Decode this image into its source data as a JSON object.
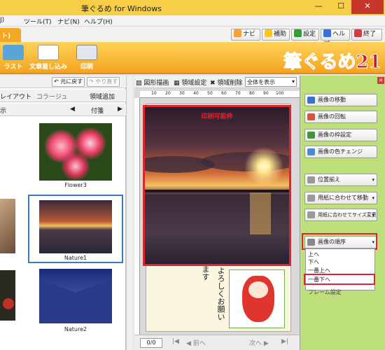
{
  "window": {
    "title": "筆ぐるめ for Windows",
    "minimize": "—",
    "maximize": "☐",
    "close": "✕"
  },
  "menu": [
    "ツール(T)",
    "ナビ(N)",
    "ヘルプ(H)"
  ],
  "menu_partial": "J)",
  "tabs": {
    "active": "ト)"
  },
  "top_buttons": [
    {
      "label": "ナビ",
      "color": "#f2a33a"
    },
    {
      "label": "補助",
      "color": "#f5c431"
    },
    {
      "label": "設定",
      "color": "#3a9a3a"
    },
    {
      "label": "ヘルプ",
      "color": "#3a6fd8"
    },
    {
      "label": "終了",
      "color": "#d43c3c"
    }
  ],
  "ribbon": {
    "items": [
      {
        "label": "ラスト"
      },
      {
        "label": "文章差し込み"
      },
      {
        "label": "印刷"
      }
    ],
    "logo": "筆ぐるめ",
    "logo_num": "21"
  },
  "left_panel": {
    "undo": "元に戻す",
    "redo": "やり直す",
    "layout": "レイアウト",
    "collage": "コラージュ",
    "add_area": "領域追加",
    "view": "示",
    "fusen": "付箋",
    "thumbnails": [
      {
        "caption": "Flower3"
      },
      {
        "caption": "Nature1"
      },
      {
        "caption": "Nature2"
      }
    ]
  },
  "canvas": {
    "toolbar": {
      "draw": "図形描画",
      "area_settings": "領域設定",
      "area_delete": "領域削除",
      "zoom": "全体を表示"
    },
    "ruler_marks": [
      "10",
      "20",
      "30",
      "40",
      "50",
      "60",
      "70",
      "80",
      "90",
      "100"
    ],
    "print_area_label": "印刷可能枠",
    "card_text_1": "よろしくお願い",
    "card_text_2": "ます",
    "page_counter": "0/0",
    "prev": "前へ",
    "next": "次へ"
  },
  "right_panel": {
    "buttons": [
      {
        "label": "画像の移動",
        "color": "#3a6fd8"
      },
      {
        "label": "画像の回転",
        "color": "#d8533a"
      },
      {
        "label": "画像の枠設定",
        "color": "#3a9a3a"
      },
      {
        "label": "画像の色チェンジ",
        "color": "#4a8ad8"
      },
      {
        "label": "位置揃え",
        "color": "#666666"
      },
      {
        "label": "用紙に合わせて移動",
        "color": "#666666"
      },
      {
        "label": "用紙に合わせてサイズ変更",
        "color": "#666666"
      },
      {
        "label": "画像の順序",
        "color": "#666666"
      }
    ],
    "order_menu": [
      "上へ",
      "下へ",
      "一番上へ",
      "一番下へ"
    ],
    "partial_under_menu": "フレーム設定"
  }
}
